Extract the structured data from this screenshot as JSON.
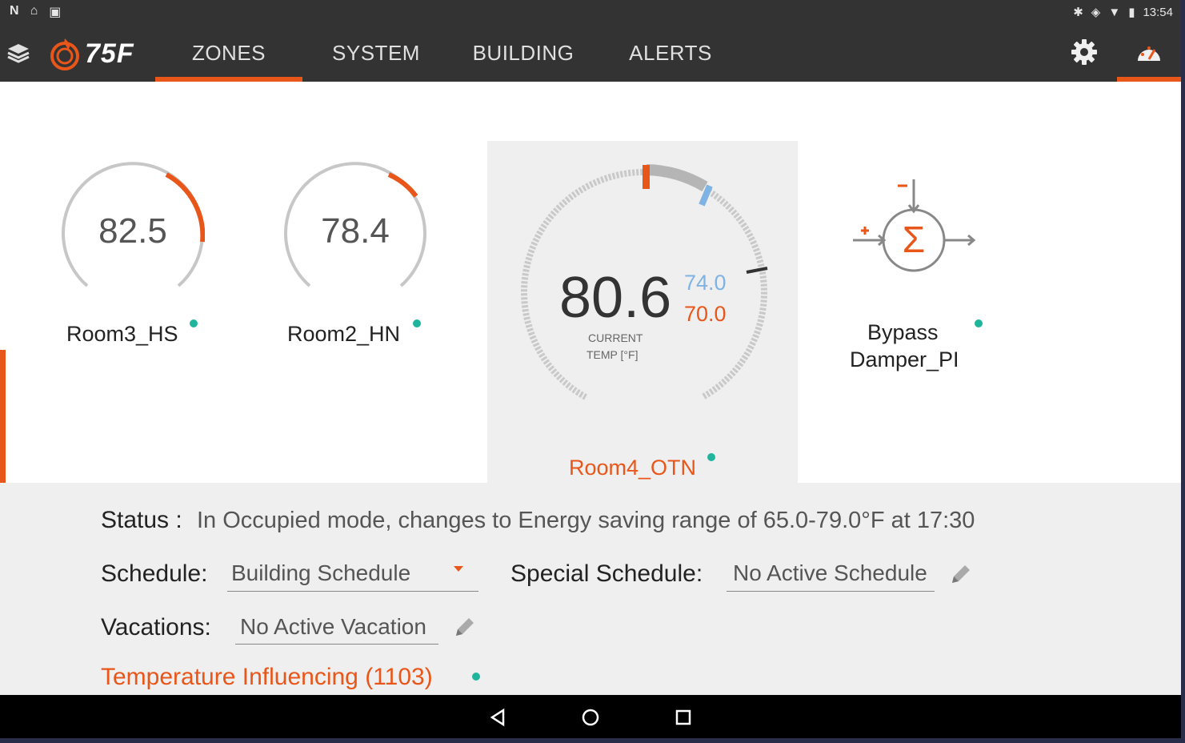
{
  "statusbar": {
    "left_icons": [
      "N",
      "⌂",
      "▣"
    ],
    "time": "13:54"
  },
  "appbar": {
    "logo": "75F",
    "tabs": [
      {
        "label": "ZONES",
        "active": true
      },
      {
        "label": "SYSTEM",
        "active": false
      },
      {
        "label": "BUILDING",
        "active": false
      },
      {
        "label": "ALERTS",
        "active": false
      }
    ],
    "accent_color": "#e9561a"
  },
  "zones": [
    {
      "name": "Room3_HS",
      "temp": "82.5"
    },
    {
      "name": "Room2_HN",
      "temp": "78.4"
    },
    {
      "name": "Room4_OTN",
      "temp": "80.6",
      "cooling": "74.0",
      "heating": "70.0",
      "current_label_1": "CURRENT",
      "current_label_2": "TEMP [°F]",
      "selected": true
    },
    {
      "name_line1": "Bypass",
      "name_line2": "Damper_PI",
      "symbol": "Σ"
    }
  ],
  "details": {
    "status_label": "Status :",
    "status_text": "In Occupied mode, changes to Energy saving range of 65.0-79.0°F at 17:30",
    "schedule_label": "Schedule:",
    "schedule_value": "Building Schedule",
    "special_schedule_label": "Special Schedule:",
    "special_schedule_value": "No Active Schedule",
    "vacations_label": "Vacations:",
    "vacations_value": "No Active Vacation",
    "temperature_influencing": "Temperature Influencing (1103)"
  }
}
